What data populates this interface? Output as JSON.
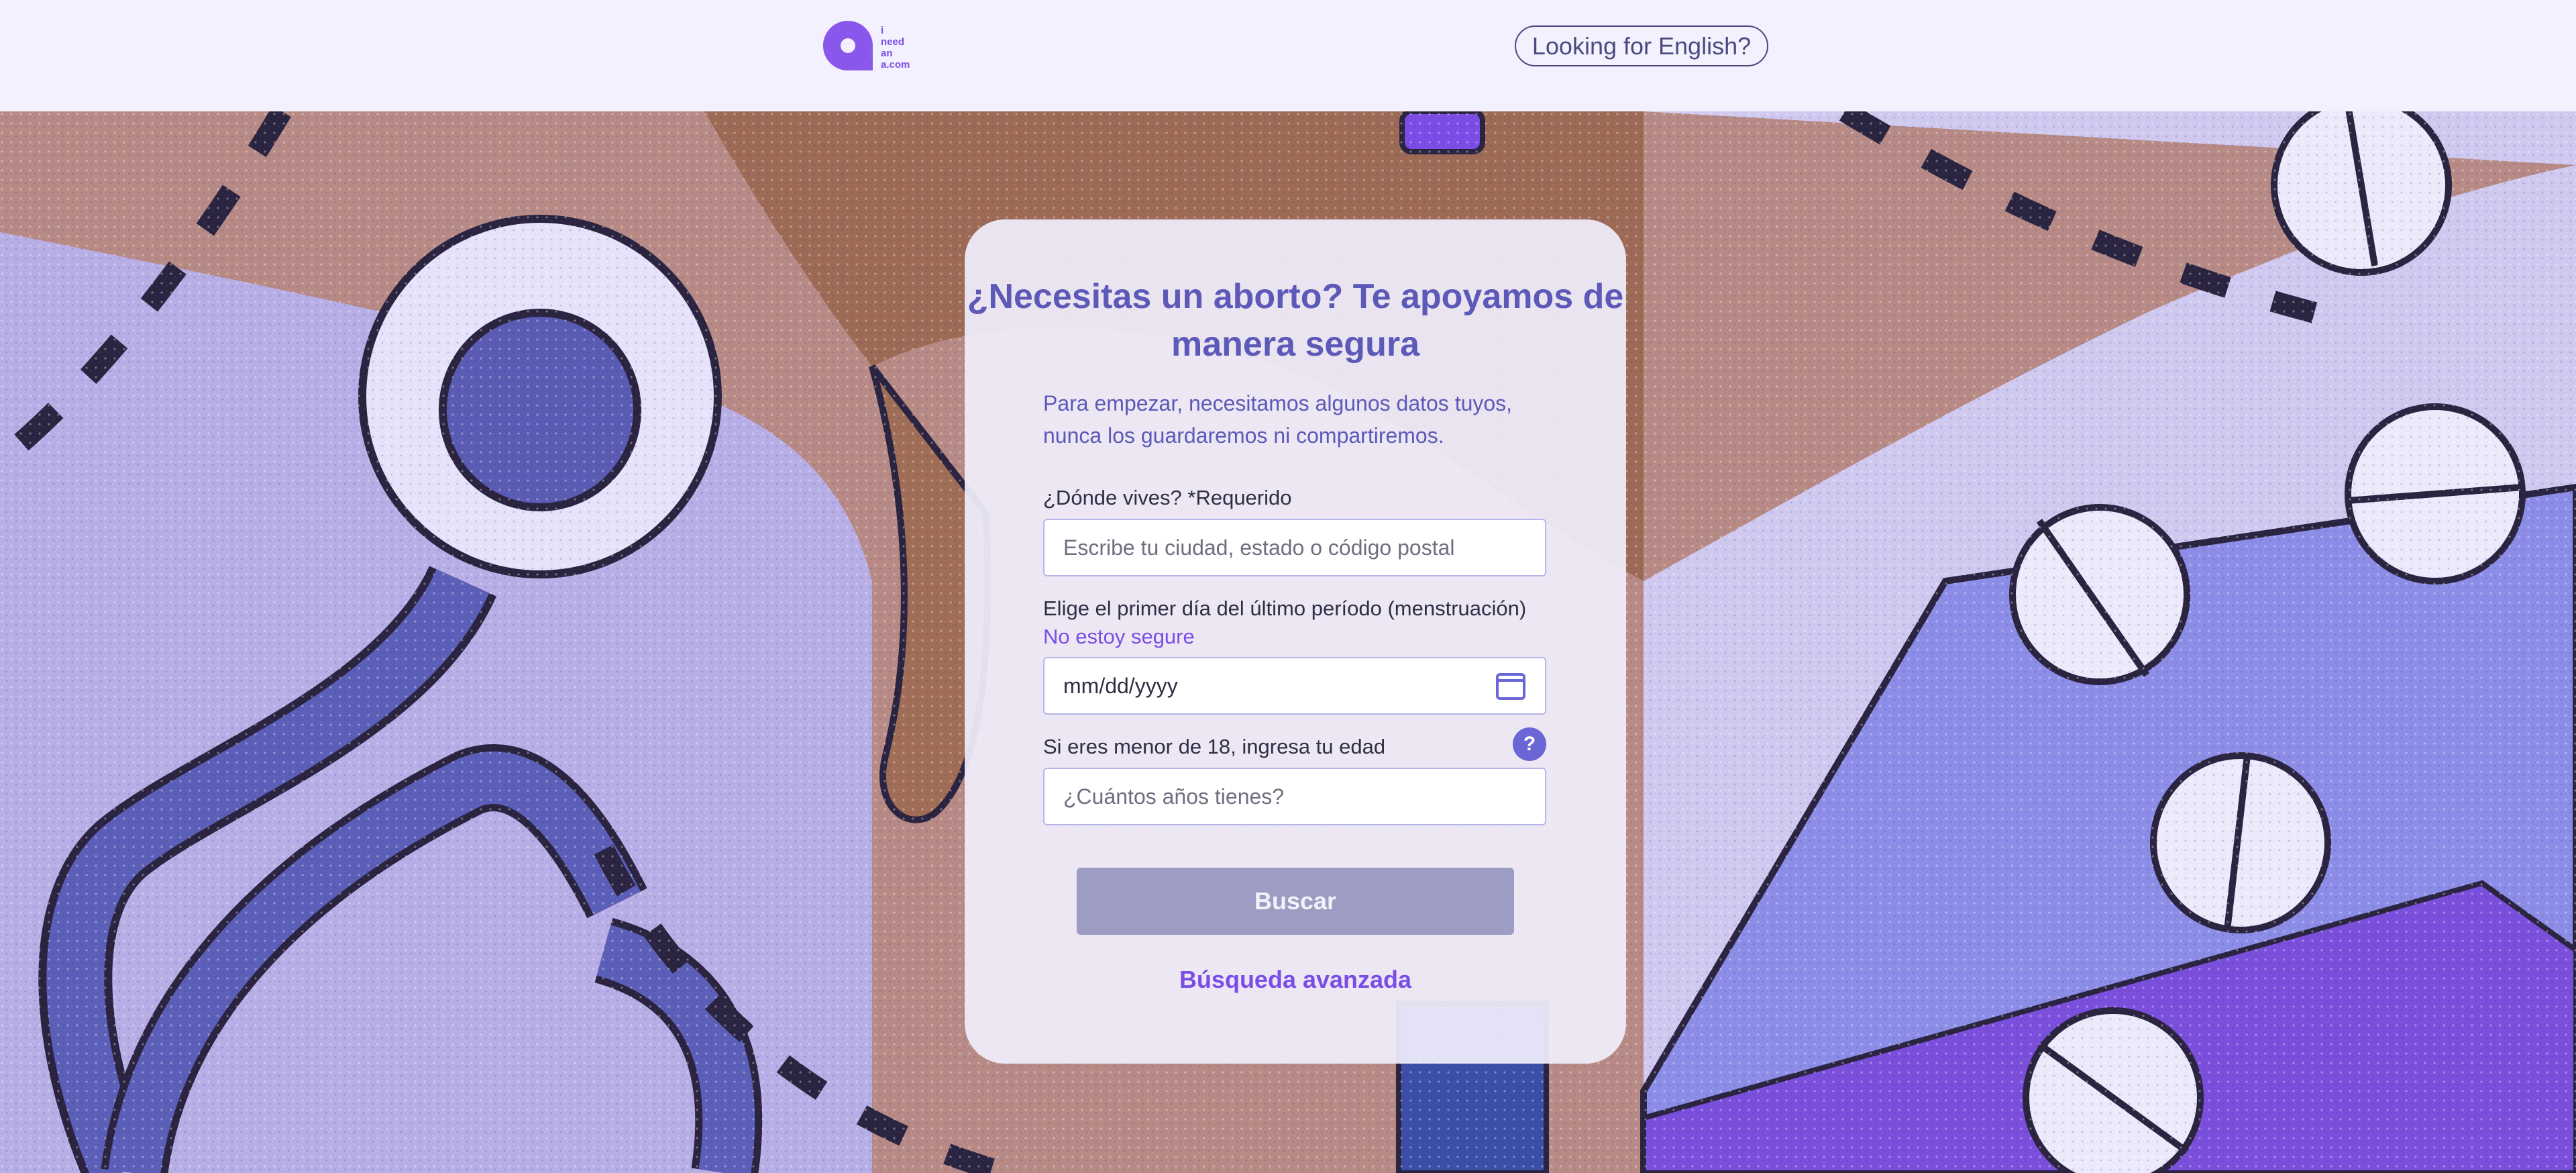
{
  "header": {
    "logo_text": [
      "i",
      "need",
      "an",
      "a.com"
    ],
    "language_button": "Looking for English?"
  },
  "form": {
    "title": "¿Necesitas un aborto? Te apoyamos de manera segura",
    "subtitle": "Para empezar, necesitamos algunos datos tuyos, nunca los guardaremos ni compartiremos.",
    "location": {
      "label": "¿Dónde vives? *Requerido",
      "placeholder": "Escribe tu ciudad, estado o código postal"
    },
    "period": {
      "label": "Elige el primer día del último período (menstruación)",
      "not_sure_link": "No estoy segure",
      "value": "mm/dd/yyyy",
      "icon": "calendar-icon"
    },
    "age": {
      "label": "Si eres menor de 18, ingresa tu edad",
      "placeholder": "¿Cuántos años tienes?",
      "help_icon": "?"
    },
    "search_button": "Buscar",
    "advanced_link": "Búsqueda avanzada"
  },
  "colors": {
    "brand_purple": "#7b4de6",
    "title_blue": "#5c59b8",
    "button_disabled": "#9d9cc2",
    "header_bg": "#f2f1fd"
  }
}
